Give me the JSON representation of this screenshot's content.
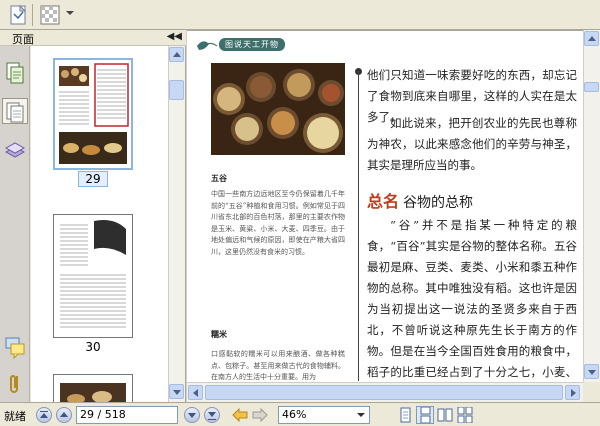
{
  "left_panel": {
    "title": "页面",
    "thumbnails": [
      {
        "page_label": "29",
        "selected": true
      },
      {
        "page_label": "30",
        "selected": false
      }
    ]
  },
  "document": {
    "header_title": "图说天工开物",
    "left_column": {
      "heading_1": "五谷",
      "paragraph_1": "中国一些南方边远地区至今仍保留着几千年前的“五谷”种植和食用习惯。例如常见于四川省东北部的百色村落，那里的主要农作物是玉米、黄粱、小米、大麦、四季豆。由于地处偏远和气候的原因，即使在产粮大省四川，这里仍然没有食米的习惯。",
      "heading_2": "糯米",
      "paragraph_2": "口感黏软的糯米可以用来酿酒、做各种糕点、包粽子。甚至用来做古代的食物辅料。在南方人的生活中十分重要。用为"
    },
    "right_column": {
      "paragraph_1": "他们只知道一味索要好吃的东西，却忘记了食物到底来自哪里，这样的人实在是太多了。",
      "paragraph_2": "如此说来，把开创农业的先民也尊称为神农，以此来感念他们的辛劳与神圣，其实是理所应当的事。",
      "section_prefix": "总名",
      "section_title": "谷物的总称",
      "paragraph_3": "“谷”并不是指某一种特定的粮食，“百谷”其实是谷物的整体名称。五谷最初是麻、豆类、麦类、小米和黍五种作物的总称。其中唯独没有稻。这也许是因为当初提出这一说法的圣贤多来自于西北，不曾听说这种原先生长于南方的作物。但是在当今全国百姓食用的粮食中，稻子的比重已经占到了十分之七，小麦、大麦和小米等加在一起仅占十分之三，而麻、豆类则完全和蔬菜、粮食一样，是桌餐上的配菜。"
    }
  },
  "status_bar": {
    "status_text": "就绪",
    "page_field": "29 / 518",
    "zoom_value": "46%"
  },
  "colors": {
    "accent": "#c23c1c",
    "header_badge": "#3d6f6b",
    "selection": "#8ab6e0"
  },
  "icons": [
    "new-doc-icon",
    "pattern-icon",
    "pages-panel-icon",
    "bookmark-panel-icon",
    "layers-panel-icon",
    "comments-panel-icon",
    "attachments-icon",
    "first-page-icon",
    "prev-page-icon",
    "next-page-icon",
    "last-page-icon",
    "back-icon",
    "forward-icon",
    "single-page-icon",
    "continuous-icon",
    "facing-icon",
    "continuous-facing-icon"
  ]
}
